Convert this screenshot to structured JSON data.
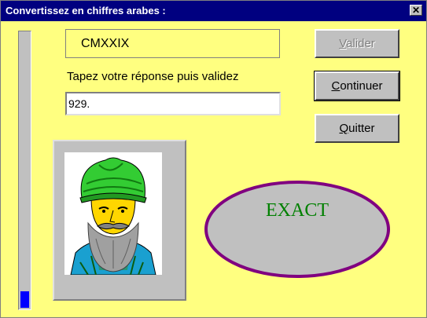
{
  "window": {
    "title": "Convertissez en chiffres arabes  :",
    "close_symbol": "✕"
  },
  "exercise": {
    "roman_numeral": "CMXXIX",
    "instruction": "Tapez votre réponse puis validez",
    "answer": "929."
  },
  "buttons": {
    "validate": {
      "label_prefix": "",
      "label_u": "V",
      "label_rest": "alider"
    },
    "continue": {
      "label_prefix": "",
      "label_u": "C",
      "label_rest": "ontinuer"
    },
    "quit": {
      "label_prefix": "",
      "label_u": "Q",
      "label_rest": "uitter"
    }
  },
  "result": {
    "text": "EXACT"
  },
  "progress": {
    "fraction": 0.06
  },
  "colors": {
    "background": "#ffff80",
    "titlebar": "#000080",
    "result_text": "#008000",
    "result_border": "#800080",
    "progress_fill": "#0000ff"
  },
  "portrait": {
    "icon": "turbaned-man-portrait"
  }
}
